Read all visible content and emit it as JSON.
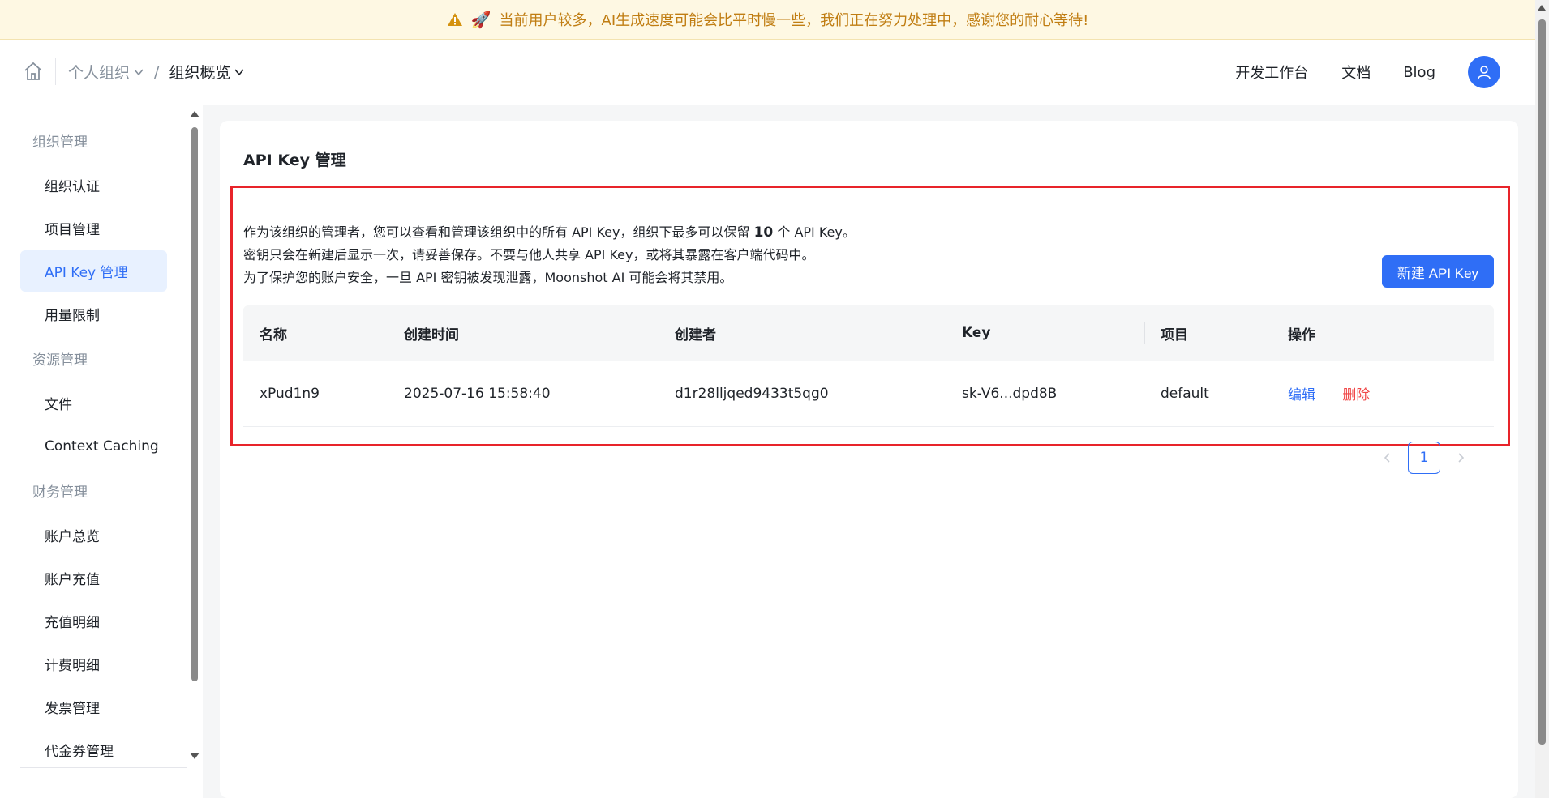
{
  "banner": {
    "text": "当前用户较多，AI生成速度可能会比平时慢一些，我们正在努力处理中，感谢您的耐心等待!"
  },
  "header": {
    "breadcrumb": [
      "个人组织",
      "组织概览"
    ],
    "nav": [
      "开发工作台",
      "文档",
      "Blog"
    ]
  },
  "sidebar": {
    "groups": [
      {
        "label": "组织管理",
        "items": [
          "组织认证",
          "项目管理",
          "API Key 管理",
          "用量限制"
        ]
      },
      {
        "label": "资源管理",
        "items": [
          "文件",
          "Context Caching"
        ]
      },
      {
        "label": "财务管理",
        "items": [
          "账户总览",
          "账户充值",
          "充值明细",
          "计费明细",
          "发票管理",
          "代金券管理"
        ]
      }
    ],
    "active_item": "API Key 管理"
  },
  "main": {
    "title": "API Key 管理",
    "notice": {
      "line1_pre": "作为该组织的管理者，您可以查看和管理该组织中的所有 API Key，组织下最多可以保留 ",
      "line1_num": "10",
      "line1_post": " 个 API Key。",
      "line2": "密钥只会在新建后显示一次，请妥善保存。不要与他人共享 API Key，或将其暴露在客户端代码中。",
      "line3": "为了保护您的账户安全，一旦 API 密钥被发现泄露，Moonshot AI 可能会将其禁用。"
    },
    "new_button": "新建 API Key",
    "table": {
      "columns": [
        "名称",
        "创建时间",
        "创建者",
        "Key",
        "项目",
        "操作"
      ],
      "rows": [
        {
          "name": "xPud1n9",
          "created": "2025-07-16 15:58:40",
          "creator": "d1r28lljqed9433t5qg0",
          "key": "sk-V6...dpd8B",
          "project": "default",
          "edit": "编辑",
          "delete": "删除"
        }
      ]
    },
    "pagination": {
      "current": "1"
    }
  },
  "colors": {
    "accent": "#2f6ef6",
    "danger": "#f04848",
    "highlight": "#e8242a",
    "banner_text": "#c07d12"
  }
}
